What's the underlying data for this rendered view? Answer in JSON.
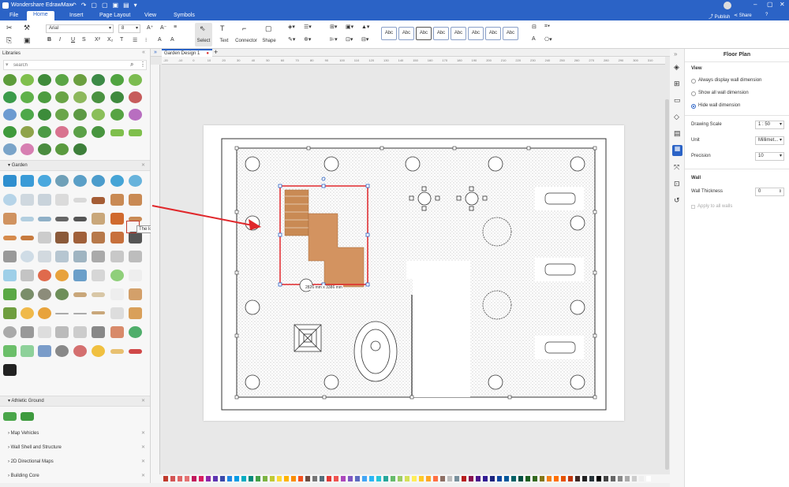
{
  "app": {
    "title": "Wondershare EdrawMax"
  },
  "menu": {
    "items": [
      "File",
      "Home",
      "Insert",
      "Page Layout",
      "View",
      "Symbols"
    ],
    "publish": "Publish",
    "share": "Share"
  },
  "ribbon": {
    "font": "Arial",
    "font_size": "8",
    "select": "Select",
    "text": "Text",
    "connector": "Connector",
    "shape": "Shape",
    "style_sample": "Abc"
  },
  "libraries": {
    "title": "Libraries",
    "search_placeholder": "search",
    "sections": {
      "garden": "Garden",
      "athletic": "Athletic Ground",
      "map_vehicles": "Map Vehicles",
      "wall_shell": "Wall Shell and Structure",
      "directional": "2D Directional Maps",
      "building_core": "Building Core"
    },
    "tooltip": "The long corridor and bridge"
  },
  "document": {
    "tab": "Garden Design 1",
    "dimension_label": "2826 mm x 3386 mm"
  },
  "ruler": {
    "ticks": [
      "-20",
      "-10",
      "0",
      "10",
      "20",
      "30",
      "40",
      "50",
      "60",
      "70",
      "80",
      "90",
      "100",
      "110",
      "120",
      "130",
      "140",
      "150",
      "160",
      "170",
      "180",
      "190",
      "200",
      "210",
      "220",
      "230",
      "240",
      "250",
      "260",
      "270",
      "280",
      "290",
      "300",
      "310"
    ]
  },
  "panel": {
    "title": "Floor Plan",
    "view_heading": "View",
    "view_options": [
      "Always display wall dimension",
      "Show all wall dimension",
      "Hide wall dimension"
    ],
    "drawing_scale_label": "Drawing Scale",
    "drawing_scale": "1 : 50",
    "unit_label": "Unit",
    "unit": "Millimet...",
    "precision_label": "Precision",
    "precision": "10",
    "wall_heading": "Wall",
    "wall_thickness_label": "Wall Thickness",
    "wall_thickness": "0",
    "apply_all": "Apply to all walls"
  },
  "colors": {
    "brand": "#2b63c6",
    "selection": "#e0272b",
    "wood": "#c98a54"
  }
}
